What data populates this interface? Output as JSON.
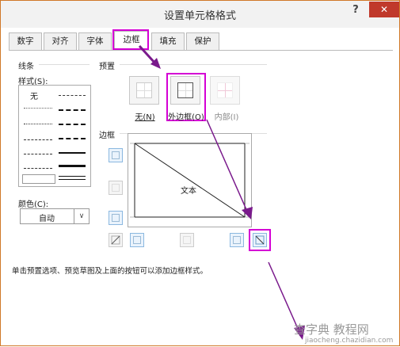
{
  "dialog": {
    "title": "设置单元格格式",
    "help_glyph": "?",
    "close_glyph": "✕"
  },
  "tabs": [
    {
      "label": "数字"
    },
    {
      "label": "对齐"
    },
    {
      "label": "字体"
    },
    {
      "label": "边框",
      "active": true
    },
    {
      "label": "填充"
    },
    {
      "label": "保护"
    }
  ],
  "line": {
    "section": "线条",
    "style_label": "样式(S):",
    "style_none": "无",
    "color_label": "颜色(C):",
    "color_value": "自动",
    "dropdown_glyph": "∨"
  },
  "presets": {
    "section": "预置",
    "items": [
      {
        "label": "无(N)"
      },
      {
        "label": "外边框(O)"
      },
      {
        "label": "内部(I)",
        "disabled": true
      }
    ]
  },
  "border": {
    "section": "边框",
    "preview_text": "文本"
  },
  "footer": {
    "text": "单击预置选项、预览草图及上面的按钮可以添加边框样式。"
  },
  "watermark": {
    "line1": "查字典 教程网",
    "line2": "jiaocheng.chazidian.com"
  },
  "colors": {
    "highlight": "#d400d4",
    "arrow": "#7a1a8c",
    "close": "#c0392b"
  }
}
